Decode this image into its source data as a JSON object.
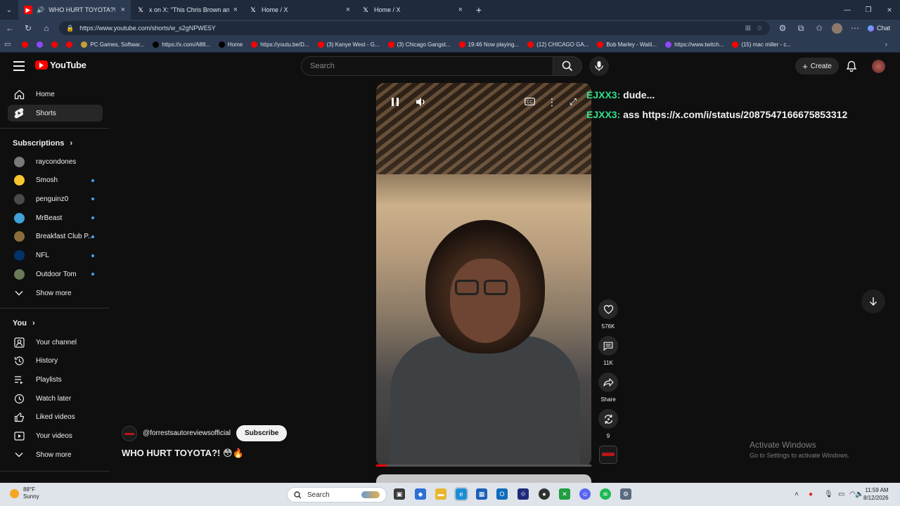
{
  "browser": {
    "tabs": [
      {
        "label": "WHO HURT TOYOTA?! 😳🔥",
        "icon": "youtube-icon",
        "active": true
      },
      {
        "label": "x on X: \"This Chris Brown and Ush",
        "icon": "x-icon",
        "active": false
      },
      {
        "label": "Home / X",
        "icon": "x-icon",
        "active": false
      },
      {
        "label": "Home / X",
        "icon": "x-icon",
        "active": false
      }
    ],
    "new_tab": "+",
    "url": "https://www.youtube.com/shorts/w_s2gNPWE5Y",
    "bookmarks": [
      {
        "label": "",
        "color": "#ff0000"
      },
      {
        "label": "",
        "color": "#9146ff"
      },
      {
        "label": "",
        "color": "#ff0000"
      },
      {
        "label": "",
        "color": "#ff0000"
      },
      {
        "label": "PC Games, Softwar...",
        "color": "#c8a038"
      },
      {
        "label": "https://x.com/A88...",
        "color": "#000000"
      },
      {
        "label": "Home",
        "color": "#000000"
      },
      {
        "label": "https://youtu.be/D...",
        "color": "#ff0000"
      },
      {
        "label": "(3) Kanye West - G...",
        "color": "#ff0000"
      },
      {
        "label": "(3) Chicago Gangst...",
        "color": "#ff0000"
      },
      {
        "label": "19:46 Now playing...",
        "color": "#ff0000"
      },
      {
        "label": "(12) CHICAGO GA...",
        "color": "#ff0000"
      },
      {
        "label": "Bob Marley - Waiti...",
        "color": "#ff0000"
      },
      {
        "label": "https://www.twitch...",
        "color": "#9146ff"
      },
      {
        "label": "(15) mac miller - c...",
        "color": "#ff0000"
      }
    ],
    "chat_button": "Chat"
  },
  "youtube": {
    "logo": "YouTube",
    "search_placeholder": "Search",
    "create_label": "Create",
    "sidebar": {
      "top": [
        {
          "label": "Home",
          "icon": "home-icon"
        },
        {
          "label": "Shorts",
          "icon": "shorts-icon",
          "selected": true
        }
      ],
      "subscriptions_header": "Subscriptions",
      "subscriptions": [
        {
          "label": "raycondones",
          "color": "#7a7a7a",
          "dot": false
        },
        {
          "label": "Smosh",
          "color": "#f7c52d",
          "dot": true
        },
        {
          "label": "penguinz0",
          "color": "#4a4a4a",
          "dot": true
        },
        {
          "label": "MrBeast",
          "color": "#41a0d8",
          "dot": true
        },
        {
          "label": "Breakfast Club P...",
          "color": "#8a6d3b",
          "dot": true
        },
        {
          "label": "NFL",
          "color": "#013369",
          "dot": true
        },
        {
          "label": "Outdoor Tom",
          "color": "#6b7a58",
          "dot": true
        }
      ],
      "show_more_1": "Show more",
      "you_header": "You",
      "you_items": [
        {
          "label": "Your channel",
          "icon": "your-channel-icon"
        },
        {
          "label": "History",
          "icon": "history-icon"
        },
        {
          "label": "Playlists",
          "icon": "playlists-icon"
        },
        {
          "label": "Watch later",
          "icon": "watch-later-icon"
        },
        {
          "label": "Liked videos",
          "icon": "liked-videos-icon"
        },
        {
          "label": "Your videos",
          "icon": "your-videos-icon"
        }
      ],
      "show_more_2": "Show more"
    },
    "short": {
      "channel": "@forrestsautoreviewsofficial",
      "subscribe": "Subscribe",
      "title": "WHO HURT TOYOTA?! 😳🔥",
      "likes": "576K",
      "comments": "11K",
      "share": "Share",
      "remix": "9",
      "progress": 0.05
    },
    "chat_overlay": [
      {
        "user": "EJXX3:",
        "message": "dude..."
      },
      {
        "user": "EJXX3:",
        "message": "ass https://x.com/i/status/2087547166675853312"
      }
    ]
  },
  "watermark": {
    "line1": "Activate Windows",
    "line2": "Go to Settings to activate Windows."
  },
  "taskbar": {
    "weather_temp": "88°F",
    "weather_desc": "Sunny",
    "search_label": "Search",
    "time": "11:59 AM",
    "date": "8/12/2026"
  }
}
